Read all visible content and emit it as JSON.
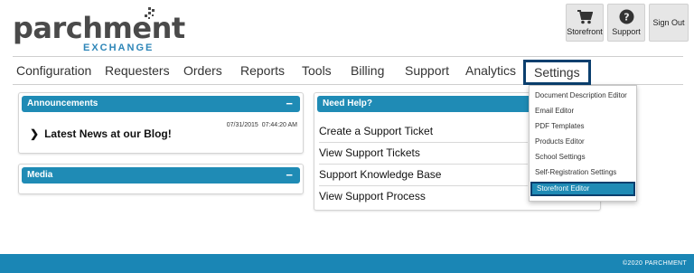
{
  "brand": {
    "name": "parchment",
    "sub": "EXCHANGE"
  },
  "top_buttons": {
    "storefront": "Storefront",
    "support": "Support",
    "signout": "Sign Out"
  },
  "nav": {
    "items": [
      "Configuration",
      "Requesters",
      "Orders",
      "Reports",
      "Tools",
      "Billing",
      "Support",
      "Analytics",
      "Settings"
    ],
    "active": "Settings"
  },
  "announcements": {
    "title": "Announcements",
    "collapse": "−",
    "date": "07/31/2015",
    "time": "07:44:20 AM",
    "item": "Latest News at our Blog!"
  },
  "media": {
    "title": "Media",
    "collapse": "−"
  },
  "help": {
    "title": "Need Help?",
    "collapse": "−",
    "links": [
      "Create a Support Ticket",
      "View Support Tickets",
      "Support Knowledge Base",
      "View Support Process"
    ]
  },
  "settings_menu": {
    "items": [
      "Document Description Editor",
      "Email Editor",
      "PDF Templates",
      "Products Editor",
      "School Settings",
      "Self-Registration Settings",
      "Storefront Editor"
    ],
    "active": "Storefront Editor"
  },
  "footer": {
    "copyright": "©2020 PARCHMENT"
  },
  "colors": {
    "accent": "#1f8bb5",
    "highlight_border": "#0b3f6e",
    "footer": "#1a86b5",
    "logo_text": "#4a4a4a",
    "logo_sub": "#2e86b8"
  }
}
